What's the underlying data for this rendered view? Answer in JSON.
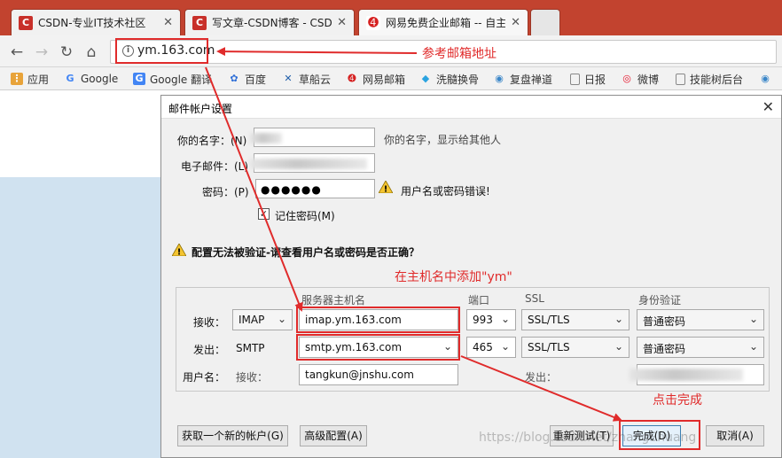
{
  "browser": {
    "tabs": [
      {
        "label": "CSDN-专业IT技术社区",
        "icon": "csdn-icon"
      },
      {
        "label": "写文章-CSDN博客 - CSD",
        "icon": "csdn-icon"
      },
      {
        "label": "网易免费企业邮箱 -- 自主",
        "icon": "netease-icon"
      }
    ],
    "url": "ym.163.com",
    "bookmarks": [
      "应用",
      "Google",
      "Google 翻译",
      "百度",
      "草船云",
      "网易邮箱",
      "洗髓换骨",
      "复盘禅道",
      "日报",
      "微博",
      "技能树后台"
    ]
  },
  "dialog": {
    "title": "邮件帐户设置",
    "name_label": "你的名字：(N)",
    "name_hint": "你的名字，显示给其他人",
    "email_label": "电子邮件：(L)",
    "password_label": "密码：(P)",
    "password_value": "●●●●●●",
    "password_error": "用户名或密码错误!",
    "remember_label": "记住密码(M)",
    "remember_checked": "✓",
    "verify_warning": "配置无法被验证-请查看用户名或密码是否正确？",
    "columns": {
      "server": "服务器主机名",
      "port": "端口",
      "ssl": "SSL",
      "auth": "身份验证"
    },
    "incoming": {
      "label": "接收：",
      "protocol": "IMAP",
      "host": "imap.ym.163.com",
      "port": "993",
      "ssl": "SSL/TLS",
      "auth": "普通密码"
    },
    "outgoing": {
      "label": "发出：",
      "protocol": "SMTP",
      "host": "smtp.ym.163.com",
      "port": "465",
      "ssl": "SSL/TLS",
      "auth": "普通密码"
    },
    "username": {
      "label": "用户名：",
      "incoming_label": "接收：",
      "incoming_value": "tangkun@jnshu.com",
      "outgoing_label": "发出："
    },
    "buttons": {
      "new_account": "获取一个新的帐户(G)",
      "advanced": "高级配置(A)",
      "retest": "重新测试(T)",
      "done": "完成(D)",
      "cancel": "取消(A)"
    }
  },
  "annotations": {
    "url_note": "参考邮箱地址",
    "host_note": "在主机名中添加\"ym\"",
    "done_note": "点击完成"
  },
  "watermark": "https://blog.csdn.net/zhangShuang",
  "colors": {
    "annotation": "#e02b2b",
    "tabstrip": "#c2432f",
    "page_bg": "#d0e2f0"
  }
}
